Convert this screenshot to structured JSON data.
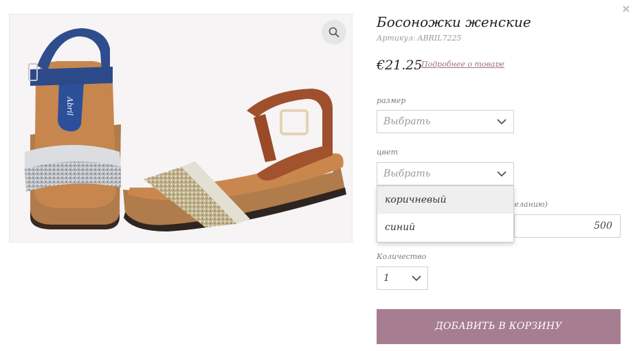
{
  "close_label": "×",
  "product": {
    "title": "Босоножки женские",
    "sku_label": "Артикул:",
    "sku_value": "ABRIL7225",
    "price": "€21.25",
    "more_link": "Подробнее о товаре",
    "image_alt_brand": "Abril"
  },
  "size_field": {
    "label": "размер",
    "placeholder": "Выбрать"
  },
  "color_field": {
    "label": "цвет",
    "placeholder": "Выбрать",
    "options": [
      "коричневый",
      "синий"
    ],
    "hovered_option": "коричневый"
  },
  "extra_field": {
    "label_partial": "желанию)",
    "value": "500"
  },
  "quantity_field": {
    "label": "Количество",
    "value": "1"
  },
  "add_to_cart": {
    "label": "Добавить в корзину"
  },
  "colors": {
    "accent": "#a77d91",
    "link": "#9b6f85",
    "border": "#cfcfcf"
  },
  "icons": {
    "zoom": "magnifier-icon",
    "close": "close-icon",
    "chevron": "chevron-down-icon"
  }
}
